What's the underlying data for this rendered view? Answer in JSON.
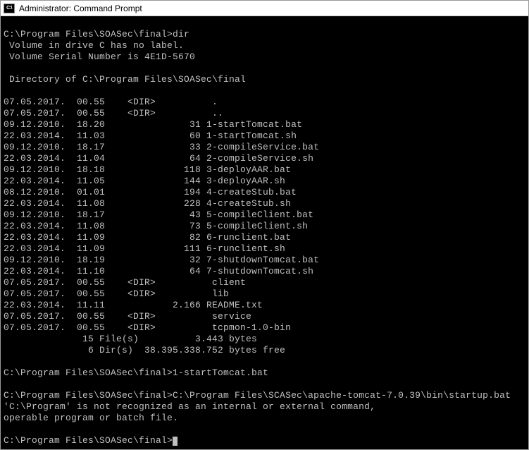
{
  "window": {
    "title": "Administrator: Command Prompt",
    "icon_label": "C:\\"
  },
  "prompt_path": "C:\\Program Files\\SOASec\\final>",
  "cmd_dir": "dir",
  "vol_line1": " Volume in drive C has no label.",
  "vol_line2": " Volume Serial Number is 4E1D-5670",
  "dir_header": " Directory of C:\\Program Files\\SOASec\\final",
  "entries": [
    {
      "date": "07.05.2017.",
      "time": "00.55",
      "dir": "<DIR>",
      "size": "",
      "name": "."
    },
    {
      "date": "07.05.2017.",
      "time": "00.55",
      "dir": "<DIR>",
      "size": "",
      "name": ".."
    },
    {
      "date": "09.12.2010.",
      "time": "18.20",
      "dir": "",
      "size": "31",
      "name": "1-startTomcat.bat"
    },
    {
      "date": "22.03.2014.",
      "time": "11.03",
      "dir": "",
      "size": "60",
      "name": "1-startTomcat.sh"
    },
    {
      "date": "09.12.2010.",
      "time": "18.17",
      "dir": "",
      "size": "33",
      "name": "2-compileService.bat"
    },
    {
      "date": "22.03.2014.",
      "time": "11.04",
      "dir": "",
      "size": "64",
      "name": "2-compileService.sh"
    },
    {
      "date": "09.12.2010.",
      "time": "18.18",
      "dir": "",
      "size": "118",
      "name": "3-deployAAR.bat"
    },
    {
      "date": "22.03.2014.",
      "time": "11.05",
      "dir": "",
      "size": "144",
      "name": "3-deployAAR.sh"
    },
    {
      "date": "08.12.2010.",
      "time": "01.01",
      "dir": "",
      "size": "194",
      "name": "4-createStub.bat"
    },
    {
      "date": "22.03.2014.",
      "time": "11.08",
      "dir": "",
      "size": "228",
      "name": "4-createStub.sh"
    },
    {
      "date": "09.12.2010.",
      "time": "18.17",
      "dir": "",
      "size": "43",
      "name": "5-compileClient.bat"
    },
    {
      "date": "22.03.2014.",
      "time": "11.08",
      "dir": "",
      "size": "73",
      "name": "5-compileClient.sh"
    },
    {
      "date": "22.03.2014.",
      "time": "11.09",
      "dir": "",
      "size": "82",
      "name": "6-runclient.bat"
    },
    {
      "date": "22.03.2014.",
      "time": "11.09",
      "dir": "",
      "size": "111",
      "name": "6-runclient.sh"
    },
    {
      "date": "09.12.2010.",
      "time": "18.19",
      "dir": "",
      "size": "32",
      "name": "7-shutdownTomcat.bat"
    },
    {
      "date": "22.03.2014.",
      "time": "11.10",
      "dir": "",
      "size": "64",
      "name": "7-shutdownTomcat.sh"
    },
    {
      "date": "07.05.2017.",
      "time": "00.55",
      "dir": "<DIR>",
      "size": "",
      "name": "client"
    },
    {
      "date": "07.05.2017.",
      "time": "00.55",
      "dir": "<DIR>",
      "size": "",
      "name": "lib"
    },
    {
      "date": "22.03.2014.",
      "time": "11.11",
      "dir": "",
      "size": "2.166",
      "name": "README.txt"
    },
    {
      "date": "07.05.2017.",
      "time": "00.55",
      "dir": "<DIR>",
      "size": "",
      "name": "service"
    },
    {
      "date": "07.05.2017.",
      "time": "00.55",
      "dir": "<DIR>",
      "size": "",
      "name": "tcpmon-1.0-bin"
    }
  ],
  "summary_files": "              15 File(s)          3.443 bytes",
  "summary_dirs": "               6 Dir(s)  38.395.338.752 bytes free",
  "cmd2": "1-startTomcat.bat",
  "cmd3_path": "C:\\Program Files\\SCASec\\apache-tomcat-7.0.39\\bin\\startup.bat",
  "err_line1": "'C:\\Program' is not recognized as an internal or external command,",
  "err_line2": "operable program or batch file."
}
